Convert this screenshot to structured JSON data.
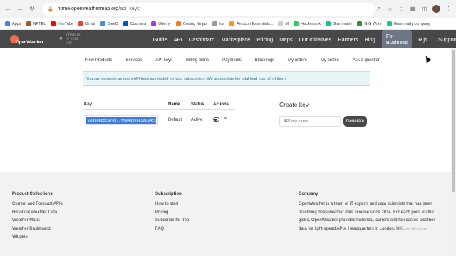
{
  "browser": {
    "url_host": "home.openweathermap.org",
    "url_path": "/api_keys",
    "bookmarks": [
      {
        "label": "Apps",
        "color": "#4285f4"
      },
      {
        "label": "NPTEL",
        "color": "#a05a2c"
      },
      {
        "label": "YouTube",
        "color": "#ff0000"
      },
      {
        "label": "Gmail",
        "color": "#ea4335"
      },
      {
        "label": "GeeC",
        "color": "#4a90d9"
      },
      {
        "label": "Coursera",
        "color": "#0056d2"
      },
      {
        "label": "Udemy",
        "color": "#a435f0"
      },
      {
        "label": "Coding Ninjas",
        "color": "#f38020"
      },
      {
        "label": "tcs",
        "color": "#999999"
      },
      {
        "label": "Amazon Essentials...",
        "color": "#ff9900"
      },
      {
        "label": "M",
        "color": "#cccccc"
      },
      {
        "label": "Hackerrank",
        "color": "#2ec866"
      },
      {
        "label": "Grammarly",
        "color": "#15c39a"
      },
      {
        "label": "GfG Write",
        "color": "#2f8d46"
      },
      {
        "label": "Grammarly company",
        "color": "#15c39a"
      }
    ]
  },
  "header": {
    "logo_text": "OpenWeather",
    "search_placeholder": "Weather in your city",
    "nav": [
      "Guide",
      "API",
      "Dashboard",
      "Marketplace",
      "Pricing",
      "Maps",
      "Our Initiatives",
      "Partners",
      "Blog"
    ],
    "for_business": "For Business",
    "user": "Rijs...",
    "support": "Support"
  },
  "tabs": [
    "New Products",
    "Services",
    "API keys",
    "Billing plans",
    "Payments",
    "Block logs",
    "My orders",
    "My profile",
    "Ask a question"
  ],
  "active_tab": "API keys",
  "info_message": "You can generate as many API keys as needed for your subscription. We accumulate the total load from all of them.",
  "keys_table": {
    "headers": {
      "key": "Key",
      "name": "Name",
      "status": "Status",
      "actions": "Actions"
    },
    "rows": [
      {
        "key": "20980bd5c97ed77ff84a396e2a034c2",
        "name": "Default",
        "status": "Active"
      }
    ]
  },
  "create_key": {
    "title": "Create key",
    "placeholder": "API key name",
    "button": "Generate"
  },
  "footer": {
    "product_title": "Product Collections",
    "product_links": [
      "Current and Forecast APIs",
      "Historical Weather Data",
      "Weather Maps",
      "Weather Dashboard",
      "Widgets"
    ],
    "subscription_title": "Subscription",
    "subscription_links": [
      "How to start",
      "Pricing",
      "Subscribe for free",
      "FAQ"
    ],
    "company_title": "Company",
    "company_lines": [
      "OpenWeather is a team of IT experts and data scientists that has been",
      "practising deep weather data science since 2014. For each point on the",
      "globe, OpenWeather provides historical, current and forecasted weather",
      "data via light-speed APIs. Headquarters in London, UK."
    ]
  },
  "watermark": "Activate Windows"
}
